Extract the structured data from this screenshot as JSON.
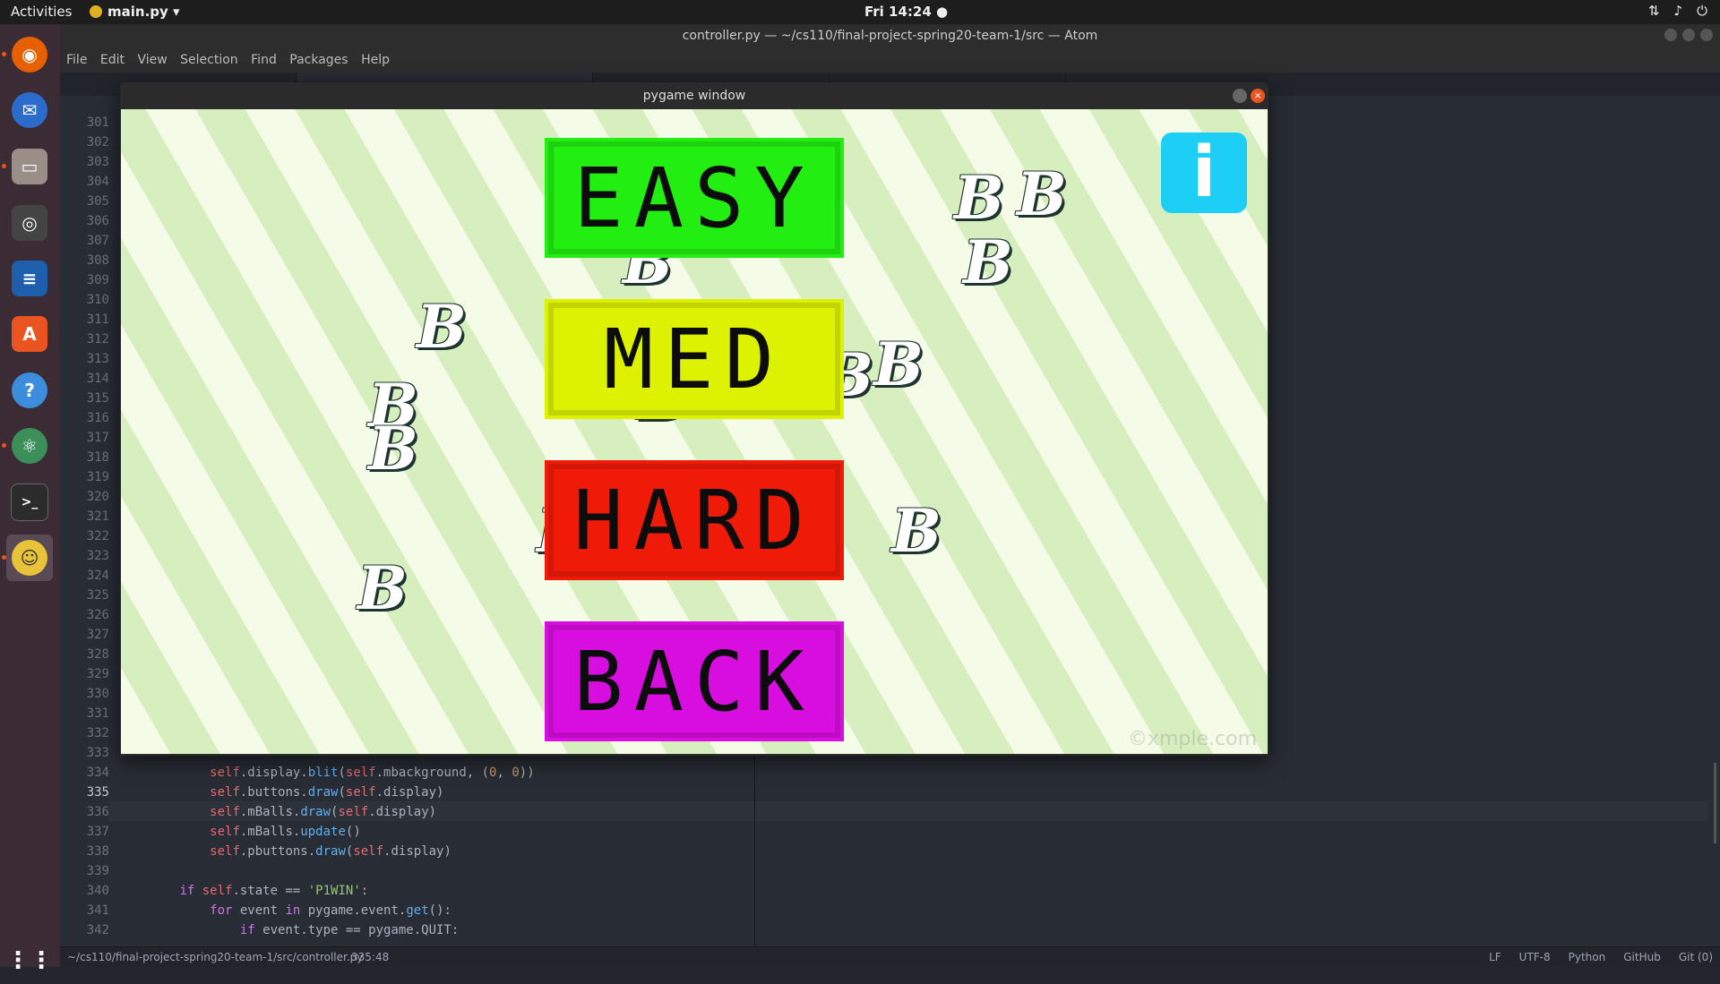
{
  "topbar": {
    "activities": "Activities",
    "app_menu": "main.py ▾",
    "clock": "Fri 14:24 ●",
    "tray_icons": [
      "network-icon",
      "volume-icon",
      "power-icon"
    ]
  },
  "dock": {
    "items": [
      "firefox-icon",
      "thunderbird-icon",
      "files-icon",
      "rhythmbox-icon",
      "writer-icon",
      "software-center-icon",
      "help-icon",
      "atom-icon",
      "terminal-icon",
      "pygame-icon"
    ],
    "show_apps_icon": "grid-icon"
  },
  "atom": {
    "title": "controller.py — ~/cs110/final-project-spring20-team-1/src — Atom",
    "menu": [
      "File",
      "Edit",
      "View",
      "Selection",
      "Find",
      "Packages",
      "Help"
    ],
    "gutter_start": 301,
    "current_line": 335,
    "code_lines": [
      {
        "n": 334,
        "text": "            self.display.blit(self.mbackground, (0, 0))"
      },
      {
        "n": 335,
        "text": "            self.buttons.draw(self.display)"
      },
      {
        "n": 336,
        "text": "            self.mBalls.draw(self.display)"
      },
      {
        "n": 337,
        "text": "            self.mBalls.update()"
      },
      {
        "n": 338,
        "text": "            self.pbuttons.draw(self.display)"
      },
      {
        "n": 339,
        "text": ""
      },
      {
        "n": 340,
        "text": "        if self.state == 'P1WIN':"
      },
      {
        "n": 341,
        "text": "            for event in pygame.event.get():"
      },
      {
        "n": 342,
        "text": "                if event.type == pygame.QUIT:"
      }
    ],
    "status": {
      "path": "~/cs110/final-project-spring20-team-1/src/controller.py",
      "cursor": "335:48",
      "right": [
        "LF",
        "UTF-8",
        "Python",
        "GitHub",
        "Git (0)"
      ]
    }
  },
  "pygame": {
    "title": "pygame window",
    "buttons": [
      {
        "label": "EASY",
        "color": "#22ee11"
      },
      {
        "label": "MED",
        "color": "#ddf200"
      },
      {
        "label": "HARD",
        "color": "#f01a08"
      },
      {
        "label": "BACK",
        "color": "#d80ee0"
      }
    ],
    "ball_letter": "B",
    "info_label": "i",
    "watermark": "©xmple.com"
  }
}
